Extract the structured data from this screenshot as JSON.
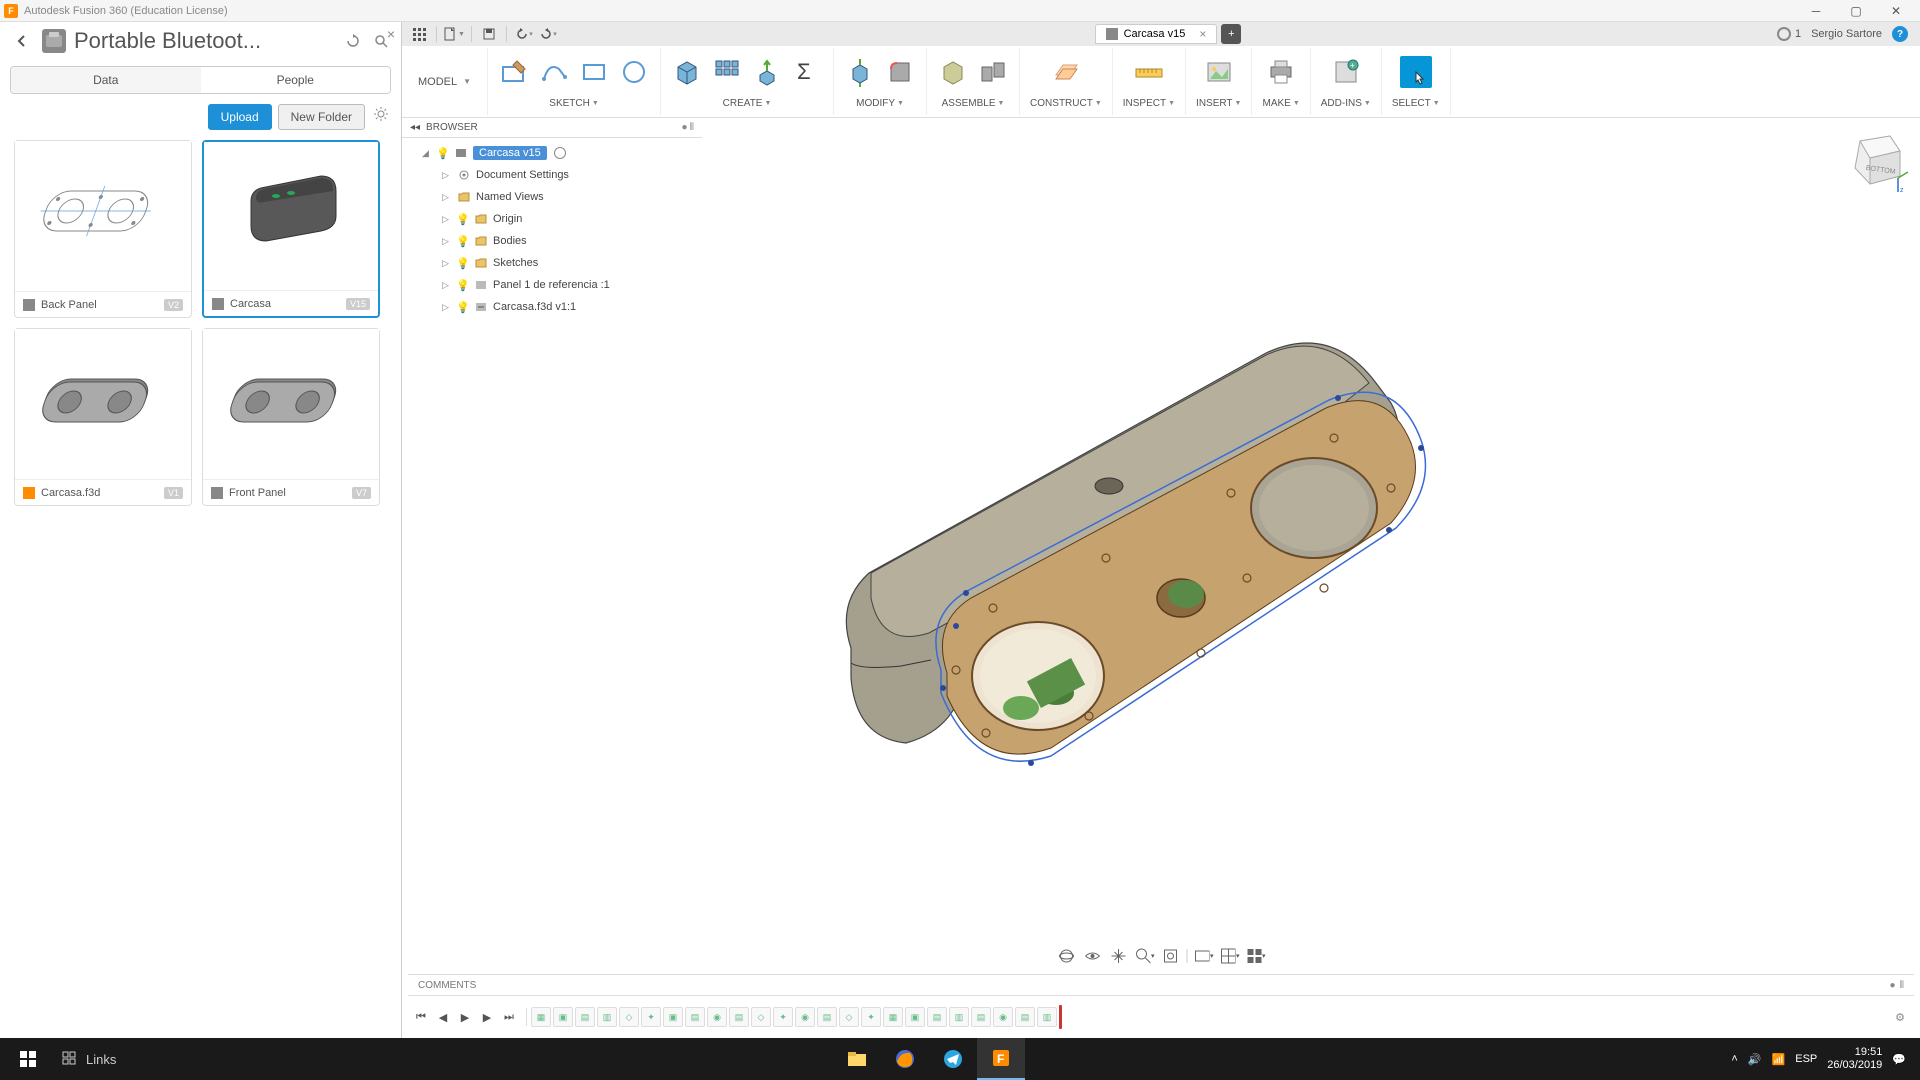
{
  "titlebar": {
    "app_name": "Autodesk Fusion 360 (Education License)"
  },
  "datapanel": {
    "project_title": "Portable Bluetoot...",
    "tabs": {
      "data": "Data",
      "people": "People"
    },
    "upload": "Upload",
    "new_folder": "New Folder",
    "items": [
      {
        "name": "Back Panel",
        "version": "V2",
        "icon": "comp"
      },
      {
        "name": "Carcasa",
        "version": "V15",
        "icon": "comp",
        "selected": true
      },
      {
        "name": "Carcasa.f3d",
        "version": "V1",
        "icon": "file"
      },
      {
        "name": "Front Panel",
        "version": "V7",
        "icon": "comp"
      }
    ]
  },
  "qat": {
    "doc_title": "Carcasa v15",
    "job_count": "1",
    "user": "Sergio Sartore"
  },
  "ribbon": {
    "workspace": "MODEL",
    "groups": [
      "SKETCH",
      "CREATE",
      "MODIFY",
      "ASSEMBLE",
      "CONSTRUCT",
      "INSPECT",
      "INSERT",
      "MAKE",
      "ADD-INS",
      "SELECT"
    ]
  },
  "browser": {
    "header": "BROWSER",
    "root": "Carcasa v15",
    "nodes": [
      "Document Settings",
      "Named Views",
      "Origin",
      "Bodies",
      "Sketches",
      "Panel 1 de referencia :1",
      "Carcasa.f3d v1:1"
    ]
  },
  "viewcube": {
    "face": "BOTTOM"
  },
  "comments": {
    "label": "COMMENTS"
  },
  "taskbar": {
    "search": "Links",
    "lang": "ESP",
    "time": "19:51",
    "date": "26/03/2019"
  }
}
